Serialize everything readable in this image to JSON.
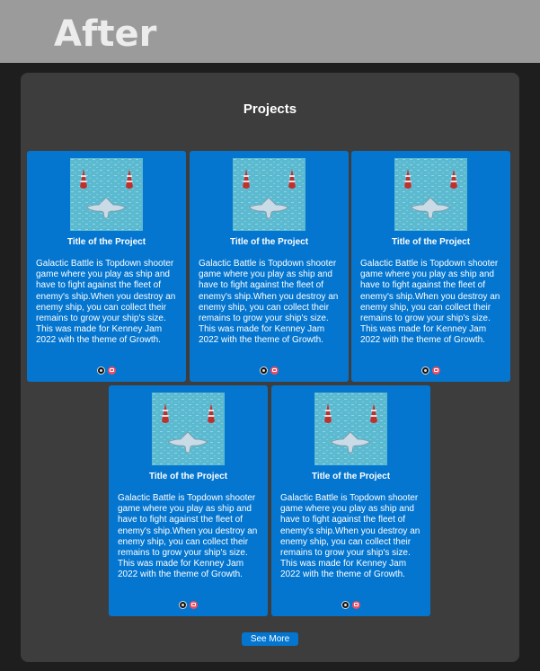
{
  "header": {
    "label": "After"
  },
  "section": {
    "title": "Projects"
  },
  "projects": [
    {
      "title": "Title of the Project",
      "description": "Galactic Battle is Topdown shooter game where you play as ship and have to fight against the fleet of enemy's ship.When you destroy an enemy ship, you can collect their remains to grow your ship's size. This was made for Kenney Jam 2022 with the theme of Growth.",
      "links": [
        "github-icon",
        "itch-io-icon"
      ]
    },
    {
      "title": "Title of the Project",
      "description": "Galactic Battle is Topdown shooter game where you play as ship and have to fight against the fleet of enemy's ship.When you destroy an enemy ship, you can collect their remains to grow your ship's size. This was made for Kenney Jam 2022 with the theme of Growth.",
      "links": [
        "github-icon",
        "itch-io-icon"
      ]
    },
    {
      "title": "Title of the Project",
      "description": "Galactic Battle is Topdown shooter game where you play as ship and have to fight against the fleet of enemy's ship.When you destroy an enemy ship, you can collect their remains to grow your ship's size. This was made for Kenney Jam 2022 with the theme of Growth.",
      "links": [
        "github-icon",
        "itch-io-icon"
      ]
    },
    {
      "title": "Title of the Project",
      "description": "Galactic Battle is Topdown shooter game where you play as ship and have to fight against the fleet of enemy's ship.When you destroy an enemy ship, you can collect their remains to grow your ship's size. This was made for Kenney Jam 2022 with the theme of Growth.",
      "links": [
        "github-icon",
        "itch-io-icon"
      ]
    },
    {
      "title": "Title of the Project",
      "description": "Galactic Battle is Topdown shooter game where you play as ship and have to fight against the fleet of enemy's ship.When you destroy an enemy ship, you can collect their remains to grow your ship's size. This was made for Kenney Jam 2022 with the theme of Growth.",
      "links": [
        "github-icon",
        "itch-io-icon"
      ]
    }
  ],
  "see_more": {
    "label": "See More"
  },
  "colors": {
    "card": "#0476d0",
    "panel": "#3d3d3d",
    "background": "#1e1e1e",
    "header": "#9b9b9b"
  }
}
